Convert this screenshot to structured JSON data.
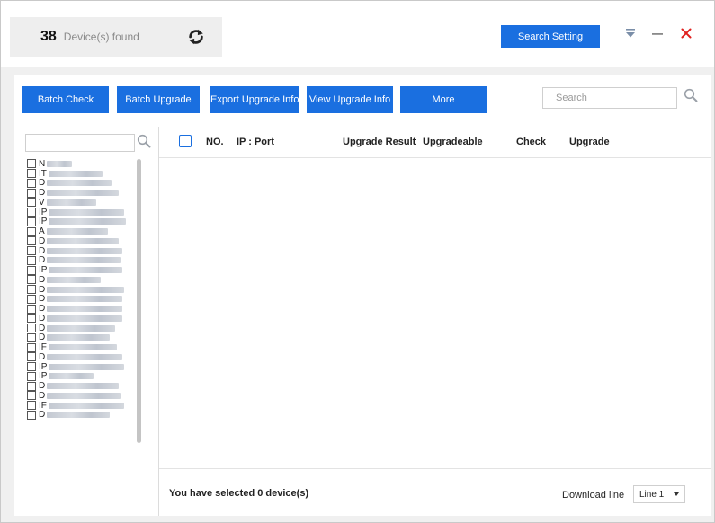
{
  "header": {
    "device_count": "38",
    "device_found_label": "Device(s) found",
    "search_setting_label": "Search Setting"
  },
  "toolbar": {
    "batch_check": "Batch Check",
    "batch_upgrade": "Batch Upgrade",
    "export_upgrade_info": "Export Upgrade Info",
    "view_upgrade_info": "View Upgrade Info",
    "more": "More",
    "search_placeholder": "Search"
  },
  "device_list": [
    "N",
    "IT",
    "D",
    "D",
    "V",
    "IP",
    "IP",
    "A",
    "D",
    "D",
    "D",
    "IP",
    "D",
    "D",
    "D",
    "D",
    "D",
    "D",
    "D",
    "IF",
    "D",
    "IP",
    "IP",
    "D",
    "D",
    "IF",
    "D"
  ],
  "table": {
    "columns": [
      "NO.",
      "IP : Port",
      "Upgrade Result",
      "Upgradeable",
      "Check",
      "Upgrade"
    ]
  },
  "footer": {
    "selected_prefix": "You have selected",
    "selected_count": "0",
    "selected_suffix": "device(s)",
    "download_line_label": "Download line",
    "download_line_value": "Line 1"
  },
  "colors": {
    "accent": "#1a6fe0",
    "close": "#e0201e",
    "background": "#f0f0f0"
  }
}
